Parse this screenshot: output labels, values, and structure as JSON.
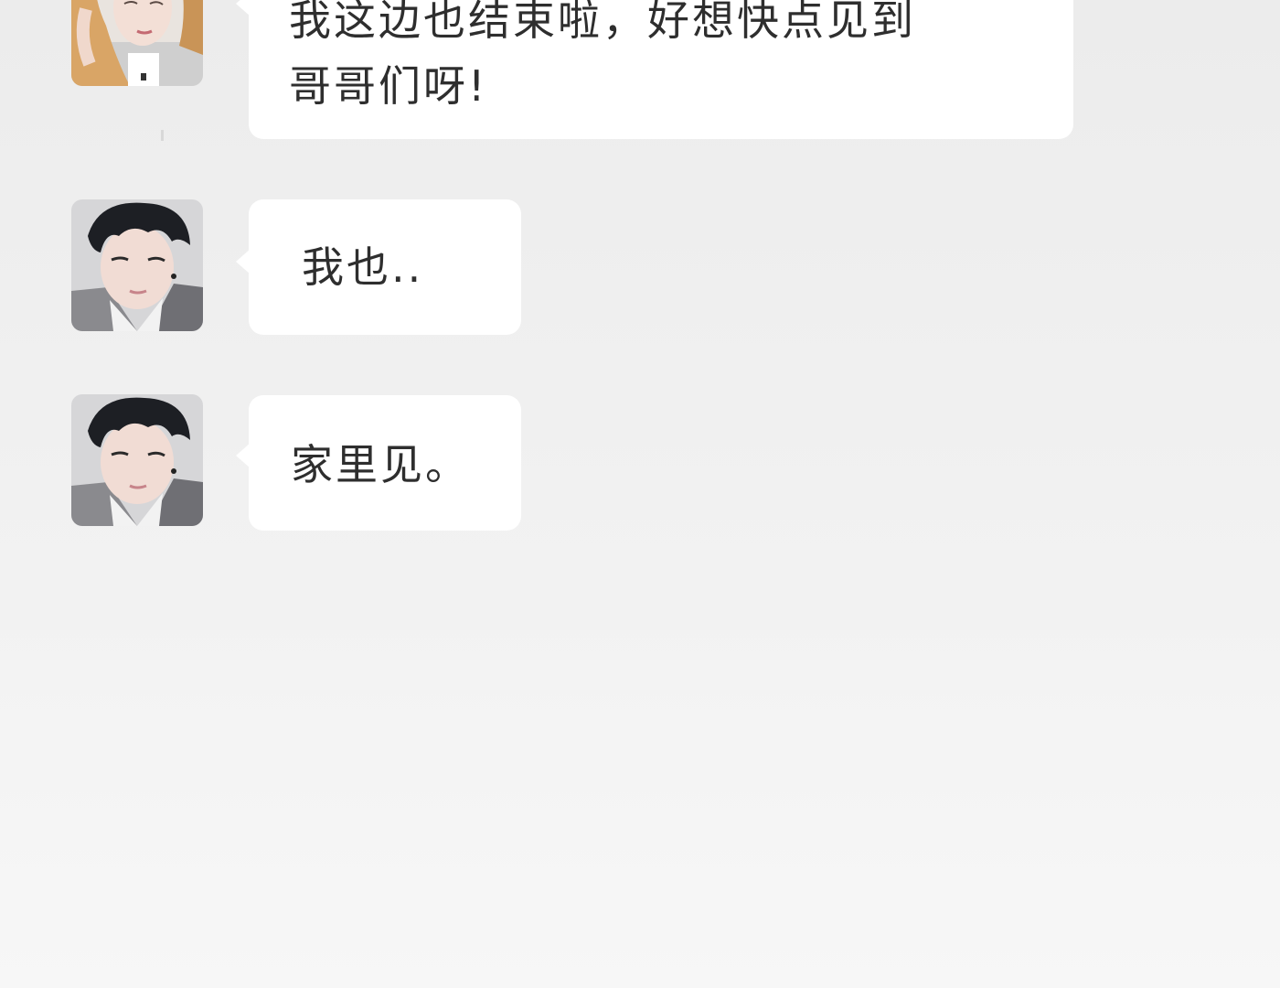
{
  "messages": [
    {
      "avatar": "blonde-character-avatar",
      "lines": [
        "我这边也结束啦，好想快点见到",
        "哥哥们呀!"
      ]
    },
    {
      "avatar": "dark-haired-character-avatar",
      "text": "我也.."
    },
    {
      "avatar": "dark-haired-character-avatar",
      "text": "家里见。"
    }
  ],
  "colors": {
    "bubble": "#ffffff",
    "text": "#2e2e2e",
    "background_top": "#ececec",
    "background_bottom": "#f7f7f7"
  }
}
